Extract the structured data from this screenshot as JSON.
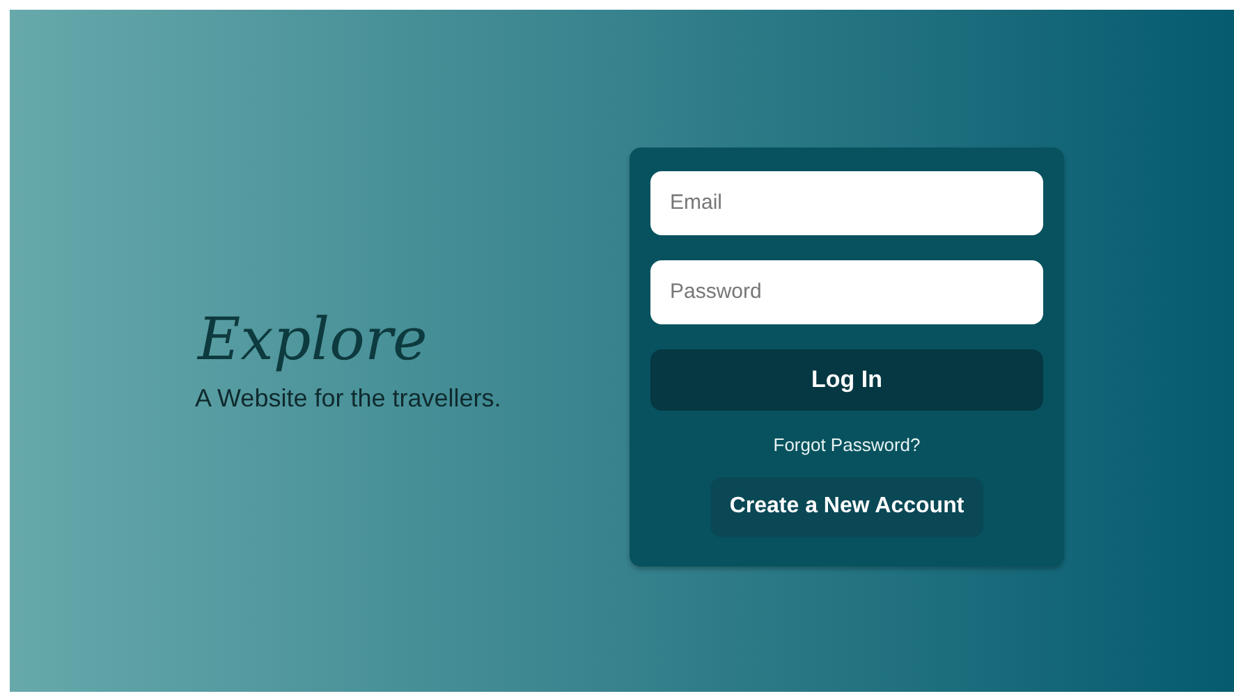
{
  "brand": {
    "title": "Explore",
    "tagline": "A Website for the travellers."
  },
  "login_form": {
    "fields": [
      {
        "placeholder": "Email"
      },
      {
        "placeholder": "Password"
      }
    ],
    "login_button": "Log In",
    "forgot_link": "Forgot Password?",
    "create_account_button": "Create a New Account"
  }
}
